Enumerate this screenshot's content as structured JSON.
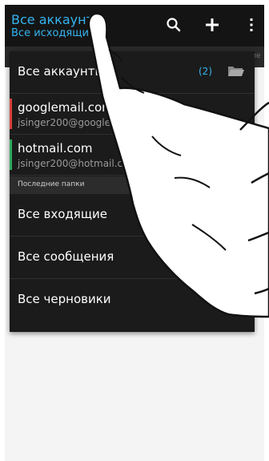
{
  "header": {
    "title": "Все аккаунты",
    "subtitle": "Все исходящие",
    "icons": [
      "search-icon",
      "plus-icon",
      "overflow-menu-icon"
    ]
  },
  "strip": {
    "partial_text": "ие"
  },
  "dropdown": {
    "all_accounts": {
      "label": "Все аккаунты",
      "count": "(2)",
      "icon": "folder-icon"
    },
    "accounts": [
      {
        "name": "googlemail.com",
        "email": "jsinger200@googlemail.com",
        "color": "#d8413a"
      },
      {
        "name": "hotmail.com",
        "email": "jsinger200@hotmail.com",
        "color": "#2eaa5f"
      }
    ],
    "section_title": "Последние папки",
    "folders": [
      "Все входящие",
      "Все сообщения",
      "Все черновики"
    ]
  },
  "colors": {
    "accent": "#34b4f0",
    "header_bg": "#141414",
    "panel_bg": "#1b1b1b"
  }
}
